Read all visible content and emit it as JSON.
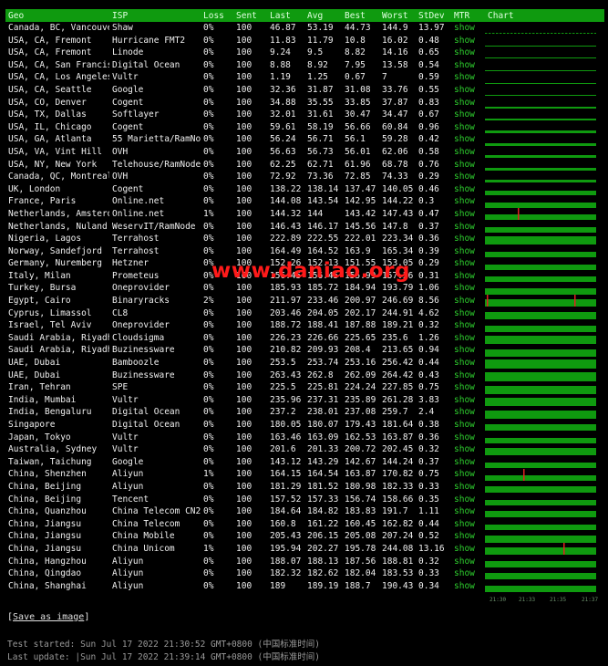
{
  "colors": {
    "header_bg": "#0f9a0f",
    "bar_green": "#0f9a0f",
    "spike_red": "#e02020",
    "mtr_link": "#2ed02e",
    "watermark": "#ff1a1a"
  },
  "table": {
    "columns": [
      "Geo",
      "ISP",
      "Loss",
      "Sent",
      "Last",
      "Avg",
      "Best",
      "Worst",
      "StDev",
      "MTR",
      "Chart"
    ],
    "rows": [
      {
        "geo": "Canada, BC, Vancouver",
        "isp": "Shaw",
        "loss": "0%",
        "sent": "100",
        "last": "46.87",
        "avg": "53.19",
        "best": "44.73",
        "worst": "144.9",
        "stdev": "13.97",
        "mtr": "show",
        "chart": {
          "level": 0.12,
          "dashed": true,
          "spikes": []
        }
      },
      {
        "geo": "USA, CA, Fremont",
        "isp": "Hurricane FMT2",
        "loss": "0%",
        "sent": "100",
        "last": "11.83",
        "avg": "11.79",
        "best": "10.8",
        "worst": "16.02",
        "stdev": "0.48",
        "mtr": "show",
        "chart": {
          "level": 0.08,
          "dashed": false,
          "spikes": []
        }
      },
      {
        "geo": "USA, CA, Fremont",
        "isp": "Linode",
        "loss": "0%",
        "sent": "100",
        "last": "9.24",
        "avg": "9.5",
        "best": "8.82",
        "worst": "14.16",
        "stdev": "0.65",
        "mtr": "show",
        "chart": {
          "level": 0.08,
          "dashed": false,
          "spikes": []
        }
      },
      {
        "geo": "USA, CA, San Francisco",
        "isp": "Digital Ocean",
        "loss": "0%",
        "sent": "100",
        "last": "8.88",
        "avg": "8.92",
        "best": "7.95",
        "worst": "13.58",
        "stdev": "0.54",
        "mtr": "show",
        "chart": {
          "level": 0.08,
          "dashed": false,
          "spikes": []
        }
      },
      {
        "geo": "USA, CA, Los Angeles",
        "isp": "Vultr",
        "loss": "0%",
        "sent": "100",
        "last": "1.19",
        "avg": "1.25",
        "best": "0.67",
        "worst": "7",
        "stdev": "0.59",
        "mtr": "show",
        "chart": {
          "level": 0.05,
          "dashed": false,
          "spikes": []
        }
      },
      {
        "geo": "USA, CA, Seattle",
        "isp": "Google",
        "loss": "0%",
        "sent": "100",
        "last": "32.36",
        "avg": "31.87",
        "best": "31.08",
        "worst": "33.76",
        "stdev": "0.55",
        "mtr": "show",
        "chart": {
          "level": 0.12,
          "dashed": false,
          "spikes": []
        }
      },
      {
        "geo": "USA, CO, Denver",
        "isp": "Cogent",
        "loss": "0%",
        "sent": "100",
        "last": "34.88",
        "avg": "35.55",
        "best": "33.85",
        "worst": "37.87",
        "stdev": "0.83",
        "mtr": "show",
        "chart": {
          "level": 0.15,
          "dashed": false,
          "spikes": []
        }
      },
      {
        "geo": "USA, TX, Dallas",
        "isp": "Softlayer",
        "loss": "0%",
        "sent": "100",
        "last": "32.01",
        "avg": "31.61",
        "best": "30.47",
        "worst": "34.47",
        "stdev": "0.67",
        "mtr": "show",
        "chart": {
          "level": 0.15,
          "dashed": false,
          "spikes": []
        }
      },
      {
        "geo": "USA, IL, Chicago",
        "isp": "Cogent",
        "loss": "0%",
        "sent": "100",
        "last": "59.61",
        "avg": "58.19",
        "best": "56.66",
        "worst": "60.84",
        "stdev": "0.96",
        "mtr": "show",
        "chart": {
          "level": 0.22,
          "dashed": false,
          "spikes": []
        }
      },
      {
        "geo": "USA, GA, Atlanta",
        "isp": "55 Marietta/RamNode",
        "loss": "0%",
        "sent": "100",
        "last": "56.24",
        "avg": "56.71",
        "best": "56.1",
        "worst": "59.28",
        "stdev": "0.42",
        "mtr": "show",
        "chart": {
          "level": 0.22,
          "dashed": false,
          "spikes": []
        }
      },
      {
        "geo": "USA, VA, Vint Hill",
        "isp": "OVH",
        "loss": "0%",
        "sent": "100",
        "last": "56.63",
        "avg": "56.73",
        "best": "56.01",
        "worst": "62.06",
        "stdev": "0.58",
        "mtr": "show",
        "chart": {
          "level": 0.22,
          "dashed": false,
          "spikes": []
        }
      },
      {
        "geo": "USA, NY, New York",
        "isp": "Telehouse/RamNode",
        "loss": "0%",
        "sent": "100",
        "last": "62.25",
        "avg": "62.71",
        "best": "61.96",
        "worst": "68.78",
        "stdev": "0.76",
        "mtr": "show",
        "chart": {
          "level": 0.25,
          "dashed": false,
          "spikes": []
        }
      },
      {
        "geo": "Canada, QC, Montreal",
        "isp": "OVH",
        "loss": "0%",
        "sent": "100",
        "last": "72.92",
        "avg": "73.36",
        "best": "72.85",
        "worst": "74.33",
        "stdev": "0.29",
        "mtr": "show",
        "chart": {
          "level": 0.28,
          "dashed": false,
          "spikes": []
        }
      },
      {
        "geo": "UK, London",
        "isp": "Cogent",
        "loss": "0%",
        "sent": "100",
        "last": "138.22",
        "avg": "138.14",
        "best": "137.47",
        "worst": "140.05",
        "stdev": "0.46",
        "mtr": "show",
        "chart": {
          "level": 0.45,
          "dashed": false,
          "spikes": []
        }
      },
      {
        "geo": "France, Paris",
        "isp": "Online.net",
        "loss": "0%",
        "sent": "100",
        "last": "144.08",
        "avg": "143.54",
        "best": "142.95",
        "worst": "144.22",
        "stdev": "0.3",
        "mtr": "show",
        "chart": {
          "level": 0.47,
          "dashed": false,
          "spikes": []
        }
      },
      {
        "geo": "Netherlands, Amsterdam",
        "isp": "Online.net",
        "loss": "1%",
        "sent": "100",
        "last": "144.32",
        "avg": "144",
        "best": "143.42",
        "worst": "147.43",
        "stdev": "0.47",
        "mtr": "show",
        "chart": {
          "level": 0.47,
          "dashed": false,
          "spikes": [
            0.3
          ]
        }
      },
      {
        "geo": "Netherlands, Nuland",
        "isp": "WeservIT/RamNode",
        "loss": "0%",
        "sent": "100",
        "last": "146.43",
        "avg": "146.17",
        "best": "145.56",
        "worst": "147.8",
        "stdev": "0.37",
        "mtr": "show",
        "chart": {
          "level": 0.48,
          "dashed": false,
          "spikes": []
        }
      },
      {
        "geo": "Nigeria, Lagos",
        "isp": "Terrahost",
        "loss": "0%",
        "sent": "100",
        "last": "222.89",
        "avg": "222.55",
        "best": "222.01",
        "worst": "223.34",
        "stdev": "0.36",
        "mtr": "show",
        "chart": {
          "level": 0.72,
          "dashed": false,
          "spikes": []
        }
      },
      {
        "geo": "Norway, Sandefjord",
        "isp": "Terrahost",
        "loss": "0%",
        "sent": "100",
        "last": "164.49",
        "avg": "164.52",
        "best": "163.9",
        "worst": "165.34",
        "stdev": "0.39",
        "mtr": "show",
        "chart": {
          "level": 0.54,
          "dashed": false,
          "spikes": []
        }
      },
      {
        "geo": "Germany, Nuremberg",
        "isp": "Hetzner",
        "loss": "0%",
        "sent": "100",
        "last": "152.26",
        "avg": "152.13",
        "best": "151.55",
        "worst": "153.05",
        "stdev": "0.29",
        "mtr": "show",
        "chart": {
          "level": 0.5,
          "dashed": false,
          "spikes": []
        }
      },
      {
        "geo": "Italy, Milan",
        "isp": "Prometeus",
        "loss": "0%",
        "sent": "100",
        "last": "156.45",
        "avg": "156.45",
        "best": "155.99",
        "worst": "157.26",
        "stdev": "0.31",
        "mtr": "show",
        "chart": {
          "level": 0.52,
          "dashed": false,
          "spikes": []
        }
      },
      {
        "geo": "Turkey, Bursa",
        "isp": "Oneprovider",
        "loss": "0%",
        "sent": "100",
        "last": "185.93",
        "avg": "185.72",
        "best": "184.94",
        "worst": "193.79",
        "stdev": "1.06",
        "mtr": "show",
        "chart": {
          "level": 0.6,
          "dashed": false,
          "spikes": []
        }
      },
      {
        "geo": "Egypt, Cairo",
        "isp": "Binaryracks",
        "loss": "2%",
        "sent": "100",
        "last": "211.97",
        "avg": "233.46",
        "best": "200.97",
        "worst": "246.69",
        "stdev": "8.56",
        "mtr": "show",
        "chart": {
          "level": 0.7,
          "dashed": false,
          "spikes": [
            0.02,
            0.82
          ]
        }
      },
      {
        "geo": "Cyprus, Limassol",
        "isp": "CL8",
        "loss": "0%",
        "sent": "100",
        "last": "203.46",
        "avg": "204.05",
        "best": "202.17",
        "worst": "244.91",
        "stdev": "4.62",
        "mtr": "show",
        "chart": {
          "level": 0.68,
          "dashed": false,
          "spikes": []
        }
      },
      {
        "geo": "Israel, Tel Aviv",
        "isp": "Oneprovider",
        "loss": "0%",
        "sent": "100",
        "last": "188.72",
        "avg": "188.41",
        "best": "187.88",
        "worst": "189.21",
        "stdev": "0.32",
        "mtr": "show",
        "chart": {
          "level": 0.62,
          "dashed": false,
          "spikes": []
        }
      },
      {
        "geo": "Saudi Arabia, Riyadh",
        "isp": "Cloudsigma",
        "loss": "0%",
        "sent": "100",
        "last": "226.23",
        "avg": "226.66",
        "best": "225.65",
        "worst": "235.6",
        "stdev": "1.26",
        "mtr": "show",
        "chart": {
          "level": 0.74,
          "dashed": false,
          "spikes": []
        }
      },
      {
        "geo": "Saudi Arabia, Riyadh",
        "isp": "Buzinessware",
        "loss": "0%",
        "sent": "100",
        "last": "210.82",
        "avg": "209.93",
        "best": "208.4",
        "worst": "213.65",
        "stdev": "0.94",
        "mtr": "show",
        "chart": {
          "level": 0.7,
          "dashed": false,
          "spikes": []
        }
      },
      {
        "geo": "UAE, Dubai",
        "isp": "Bamboozle",
        "loss": "0%",
        "sent": "100",
        "last": "253.5",
        "avg": "253.74",
        "best": "253.16",
        "worst": "256.42",
        "stdev": "0.44",
        "mtr": "show",
        "chart": {
          "level": 0.82,
          "dashed": false,
          "spikes": []
        }
      },
      {
        "geo": "UAE, Dubai",
        "isp": "Buzinessware",
        "loss": "0%",
        "sent": "100",
        "last": "263.43",
        "avg": "262.8",
        "best": "262.09",
        "worst": "264.42",
        "stdev": "0.43",
        "mtr": "show",
        "chart": {
          "level": 0.86,
          "dashed": false,
          "spikes": []
        }
      },
      {
        "geo": "Iran, Tehran",
        "isp": "SPE",
        "loss": "0%",
        "sent": "100",
        "last": "225.5",
        "avg": "225.81",
        "best": "224.24",
        "worst": "227.85",
        "stdev": "0.75",
        "mtr": "show",
        "chart": {
          "level": 0.74,
          "dashed": false,
          "spikes": []
        }
      },
      {
        "geo": "India, Mumbai",
        "isp": "Vultr",
        "loss": "0%",
        "sent": "100",
        "last": "235.96",
        "avg": "237.31",
        "best": "235.89",
        "worst": "261.28",
        "stdev": "3.83",
        "mtr": "show",
        "chart": {
          "level": 0.78,
          "dashed": false,
          "spikes": []
        }
      },
      {
        "geo": "India, Bengaluru",
        "isp": "Digital Ocean",
        "loss": "0%",
        "sent": "100",
        "last": "237.2",
        "avg": "238.01",
        "best": "237.08",
        "worst": "259.7",
        "stdev": "2.4",
        "mtr": "show",
        "chart": {
          "level": 0.78,
          "dashed": false,
          "spikes": []
        }
      },
      {
        "geo": "Singapore",
        "isp": "Digital Ocean",
        "loss": "0%",
        "sent": "100",
        "last": "180.05",
        "avg": "180.07",
        "best": "179.43",
        "worst": "181.64",
        "stdev": "0.38",
        "mtr": "show",
        "chart": {
          "level": 0.6,
          "dashed": false,
          "spikes": []
        }
      },
      {
        "geo": "Japan, Tokyo",
        "isp": "Vultr",
        "loss": "0%",
        "sent": "100",
        "last": "163.46",
        "avg": "163.09",
        "best": "162.53",
        "worst": "163.87",
        "stdev": "0.36",
        "mtr": "show",
        "chart": {
          "level": 0.54,
          "dashed": false,
          "spikes": []
        }
      },
      {
        "geo": "Australia, Sydney",
        "isp": "Vultr",
        "loss": "0%",
        "sent": "100",
        "last": "201.6",
        "avg": "201.33",
        "best": "200.72",
        "worst": "202.45",
        "stdev": "0.32",
        "mtr": "show",
        "chart": {
          "level": 0.66,
          "dashed": false,
          "spikes": []
        }
      },
      {
        "geo": "Taiwan, Taichung",
        "isp": "Google",
        "loss": "0%",
        "sent": "100",
        "last": "143.12",
        "avg": "143.29",
        "best": "142.67",
        "worst": "144.24",
        "stdev": "0.37",
        "mtr": "show",
        "chart": {
          "level": 0.47,
          "dashed": false,
          "spikes": []
        }
      },
      {
        "geo": "China, Shenzhen",
        "isp": "Aliyun",
        "loss": "1%",
        "sent": "100",
        "last": "164.15",
        "avg": "164.54",
        "best": "163.87",
        "worst": "170.82",
        "stdev": "0.75",
        "mtr": "show",
        "chart": {
          "level": 0.54,
          "dashed": false,
          "spikes": [
            0.35
          ]
        }
      },
      {
        "geo": "China, Beijing",
        "isp": "Aliyun",
        "loss": "0%",
        "sent": "100",
        "last": "181.29",
        "avg": "181.52",
        "best": "180.98",
        "worst": "182.33",
        "stdev": "0.33",
        "mtr": "show",
        "chart": {
          "level": 0.6,
          "dashed": false,
          "spikes": []
        }
      },
      {
        "geo": "China, Beijing",
        "isp": "Tencent",
        "loss": "0%",
        "sent": "100",
        "last": "157.52",
        "avg": "157.33",
        "best": "156.74",
        "worst": "158.66",
        "stdev": "0.35",
        "mtr": "show",
        "chart": {
          "level": 0.52,
          "dashed": false,
          "spikes": []
        }
      },
      {
        "geo": "China, Quanzhou",
        "isp": "China Telecom CN2",
        "loss": "0%",
        "sent": "100",
        "last": "184.64",
        "avg": "184.82",
        "best": "183.83",
        "worst": "191.7",
        "stdev": "1.11",
        "mtr": "show",
        "chart": {
          "level": 0.6,
          "dashed": false,
          "spikes": []
        }
      },
      {
        "geo": "China, Jiangsu",
        "isp": "China Telecom",
        "loss": "0%",
        "sent": "100",
        "last": "160.8",
        "avg": "161.22",
        "best": "160.45",
        "worst": "162.82",
        "stdev": "0.44",
        "mtr": "show",
        "chart": {
          "level": 0.53,
          "dashed": false,
          "spikes": []
        }
      },
      {
        "geo": "China, Jiangsu",
        "isp": "China Mobile",
        "loss": "0%",
        "sent": "100",
        "last": "205.43",
        "avg": "206.15",
        "best": "205.08",
        "worst": "207.24",
        "stdev": "0.52",
        "mtr": "show",
        "chart": {
          "level": 0.68,
          "dashed": false,
          "spikes": []
        }
      },
      {
        "geo": "China, Jiangsu",
        "isp": "China Unicom",
        "loss": "1%",
        "sent": "100",
        "last": "195.94",
        "avg": "202.27",
        "best": "195.78",
        "worst": "244.08",
        "stdev": "13.16",
        "mtr": "show",
        "chart": {
          "level": 0.64,
          "dashed": false,
          "spikes": [
            0.72
          ]
        }
      },
      {
        "geo": "China, Hangzhou",
        "isp": "Aliyun",
        "loss": "0%",
        "sent": "100",
        "last": "188.07",
        "avg": "188.13",
        "best": "187.56",
        "worst": "188.81",
        "stdev": "0.32",
        "mtr": "show",
        "chart": {
          "level": 0.62,
          "dashed": false,
          "spikes": []
        }
      },
      {
        "geo": "China, Qingdao",
        "isp": "Aliyun",
        "loss": "0%",
        "sent": "100",
        "last": "182.32",
        "avg": "182.62",
        "best": "182.04",
        "worst": "183.53",
        "stdev": "0.33",
        "mtr": "show",
        "chart": {
          "level": 0.6,
          "dashed": false,
          "spikes": []
        }
      },
      {
        "geo": "China, Shanghai",
        "isp": "Aliyun",
        "loss": "0%",
        "sent": "100",
        "last": "189",
        "avg": "189.19",
        "best": "188.7",
        "worst": "190.43",
        "stdev": "0.34",
        "mtr": "show",
        "chart": {
          "level": 0.62,
          "dashed": false,
          "spikes": []
        }
      }
    ]
  },
  "chart_axis_ticks": [
    "21:30",
    "21:33",
    "21:35",
    "21:37"
  ],
  "footer": {
    "save_prefix": "[",
    "save_label": "Save as image",
    "save_suffix": "]",
    "test_started": "Test started: Sun Jul 17 2022 21:30:52 GMT+0800 (中国标准时间)",
    "last_update": "Last update: |Sun Jul 17 2022 21:39:14 GMT+0800 (中国标准时间)"
  },
  "watermark": "www.daniao.org"
}
